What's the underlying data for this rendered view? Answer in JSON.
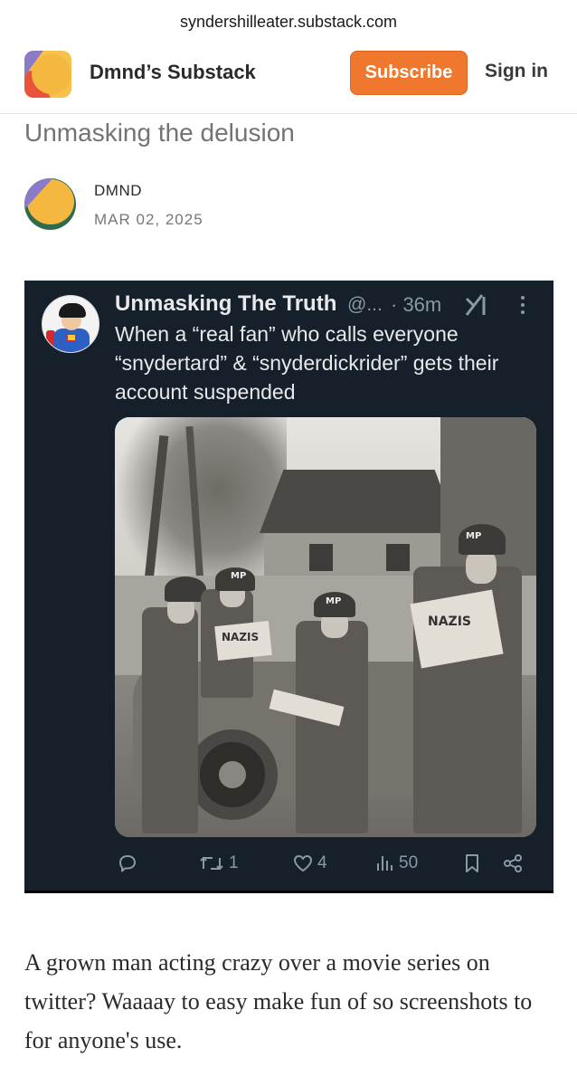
{
  "browser": {
    "url": "syndershilleater.substack.com"
  },
  "header": {
    "site_name": "Dmnd’s Substack",
    "subscribe_label": "Subscribe",
    "signin_label": "Sign in"
  },
  "post": {
    "title": "Unmasking the delusion",
    "author": "DMND",
    "date": "MAR 02, 2025",
    "body": "A grown man acting crazy over a movie series on twitter? Waaaay to easy make fun of so screenshots to for anyone's use."
  },
  "tweet": {
    "display_name": "Unmasking The Truth",
    "handle": "@...",
    "time": "· 36m",
    "text": "When a “real fan” who calls everyone “snydertard” & “snyderdickrider” gets their account suspended",
    "image": {
      "caption_newspaper": "NAZIS",
      "helmet_label": "MP"
    },
    "actions": {
      "replies": "",
      "retweets": "1",
      "likes": "4",
      "views": "50"
    },
    "icons": [
      "grok-icon",
      "more-icon",
      "reply-icon",
      "retweet-icon",
      "like-icon",
      "views-icon",
      "bookmark-icon",
      "share-icon"
    ]
  },
  "colors": {
    "accent": "#f0772e",
    "tweet_background": "#15202b",
    "tweet_text": "#e7e9ea",
    "tweet_muted": "#8b98a5"
  }
}
